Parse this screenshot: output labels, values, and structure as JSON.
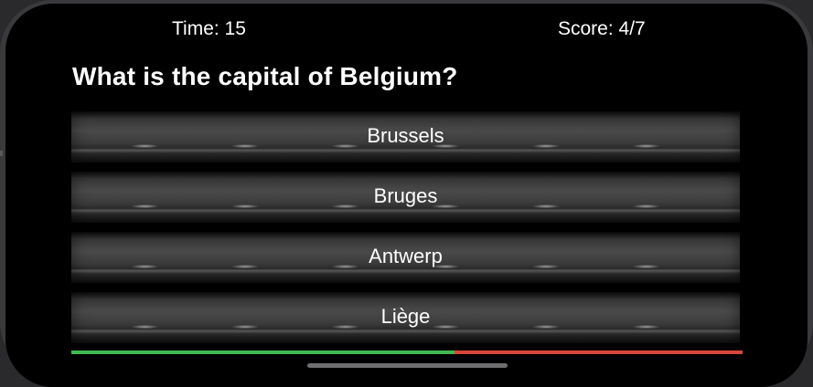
{
  "header": {
    "timer_text": "Time: 15",
    "score_text": "Score: 4/7"
  },
  "question": {
    "text": "What is the capital of Belgium?"
  },
  "answers": [
    {
      "label": "Brussels"
    },
    {
      "label": "Bruges"
    },
    {
      "label": "Antwerp"
    },
    {
      "label": "Liège"
    }
  ],
  "progress": {
    "correct": 4,
    "total": 7,
    "correct_color": "#3fb950",
    "wrong_color": "#d9453b"
  }
}
